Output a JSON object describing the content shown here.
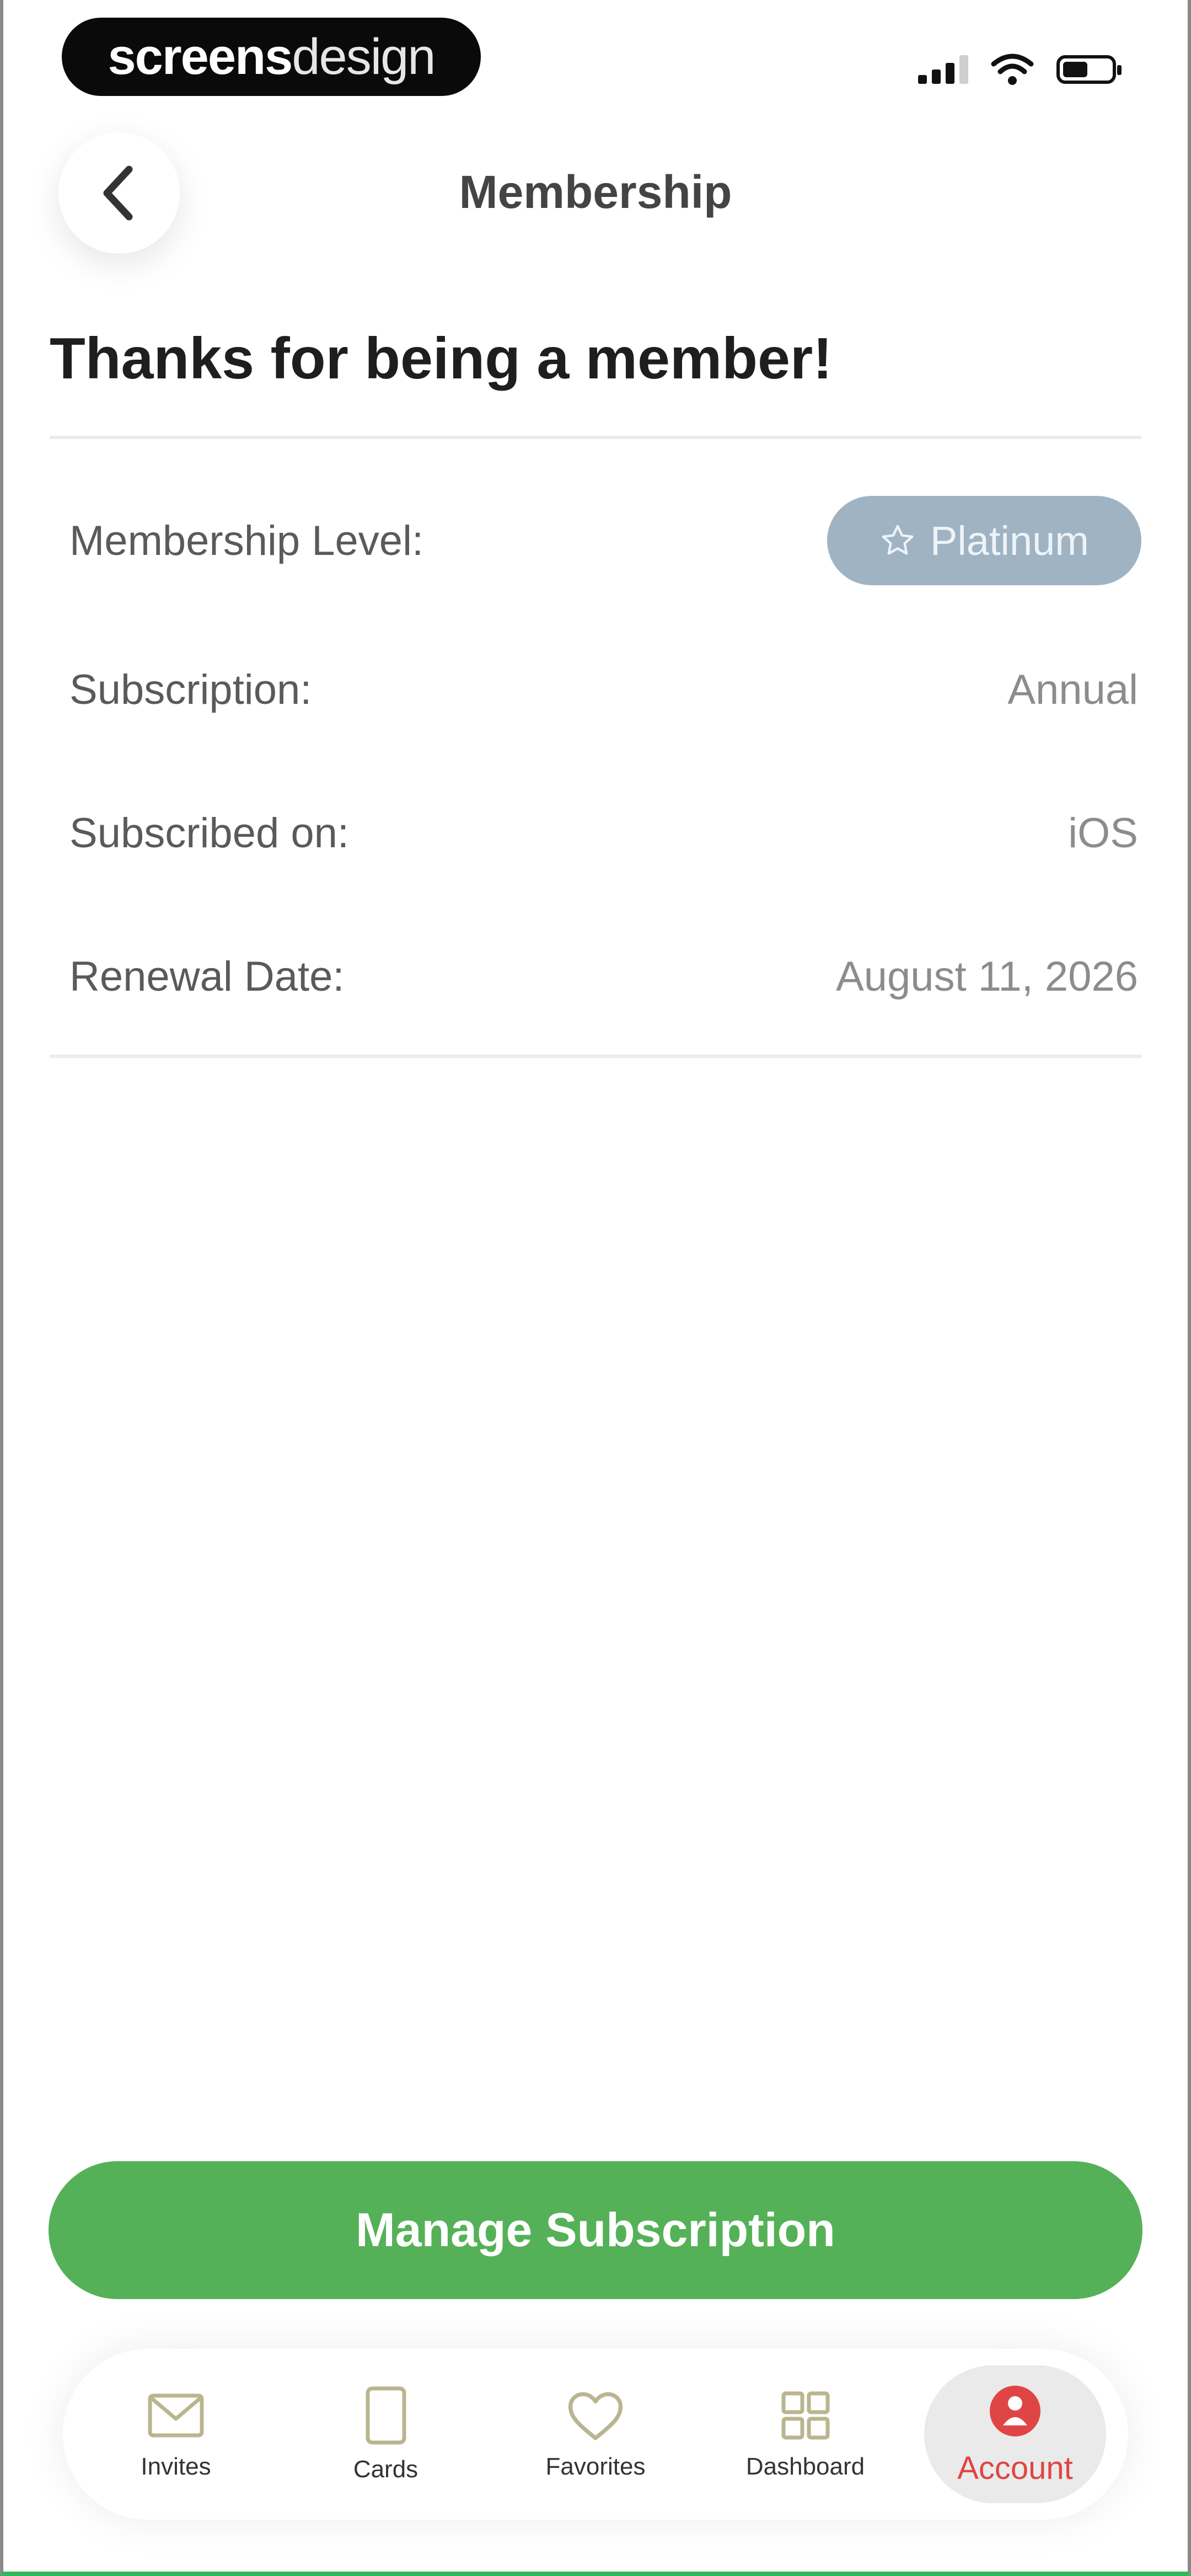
{
  "status_bar": {
    "watermark": {
      "bold": "screens",
      "light": "design"
    }
  },
  "header": {
    "title": "Membership",
    "back_icon": "chevron-left-icon"
  },
  "headline": "Thanks for being a member!",
  "details": [
    {
      "label": "Membership Level:",
      "value": "Platinum",
      "badge_icon": "star-icon"
    },
    {
      "label": "Subscription:",
      "value": "Annual"
    },
    {
      "label": "Subscribed on:",
      "value": "iOS"
    },
    {
      "label": "Renewal Date:",
      "value": "August 11, 2026"
    }
  ],
  "actions": {
    "manage_label": "Manage Subscription"
  },
  "tabbar": {
    "items": [
      {
        "label": "Invites",
        "icon": "mail-icon"
      },
      {
        "label": "Cards",
        "icon": "card-icon"
      },
      {
        "label": "Favorites",
        "icon": "heart-icon"
      },
      {
        "label": "Dashboard",
        "icon": "grid-icon"
      },
      {
        "label": "Account",
        "icon": "account-icon",
        "active": true
      }
    ]
  },
  "colors": {
    "primary_green": "#55b157",
    "badge_platinum": "#9fb3c3",
    "active_tab": "#e04545"
  }
}
